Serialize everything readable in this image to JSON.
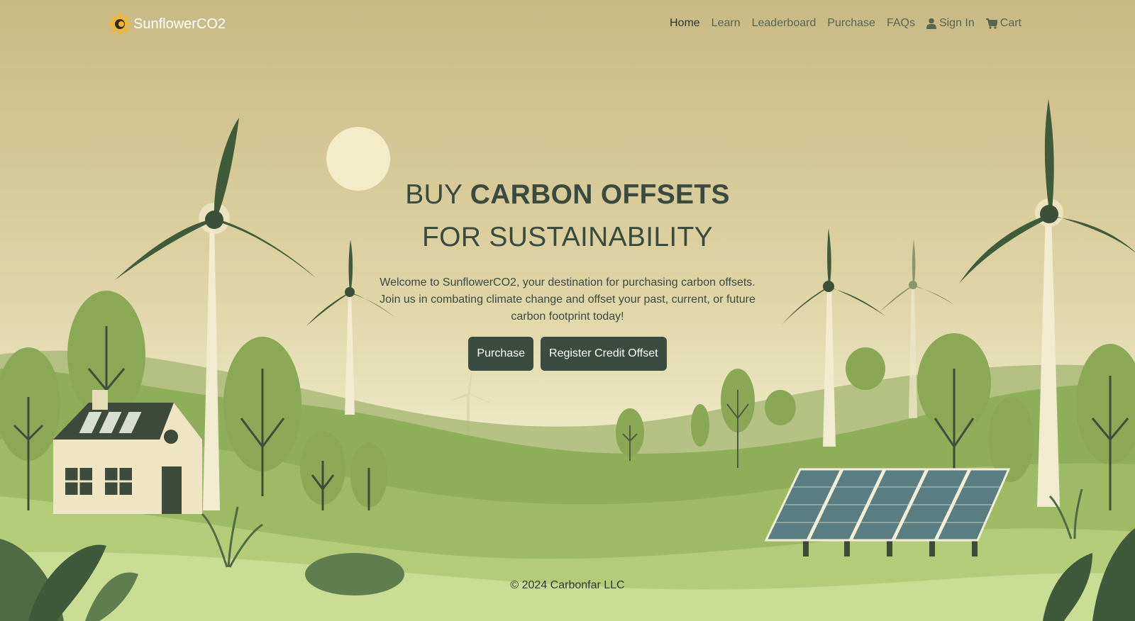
{
  "nav": {
    "brand": "SunflowerCO2",
    "links": [
      "Home",
      "Learn",
      "Leaderboard",
      "Purchase",
      "FAQs"
    ],
    "sign_in": "Sign In",
    "cart": "Cart"
  },
  "hero": {
    "title_light": "BUY ",
    "title_bold": "CARBON OFFSETS",
    "title_line2": "FOR SUSTAINABILITY",
    "description": "Welcome to SunflowerCO2, your destination for purchasing carbon offsets. Join us in combating climate change and offset your past, current, or future carbon footprint today!",
    "primary_button": "Purchase",
    "secondary_button": "Register Credit Offset"
  },
  "footer": {
    "copyright": "© 2024 Carbonfar LLC"
  },
  "colors": {
    "sky_top": "#c9b983",
    "sky_bottom": "#ece9c4",
    "button": "#3c4b3f",
    "nav_link": "#56664f",
    "dark_green": "#3e5b3b",
    "light_green": "#8fb05a"
  }
}
